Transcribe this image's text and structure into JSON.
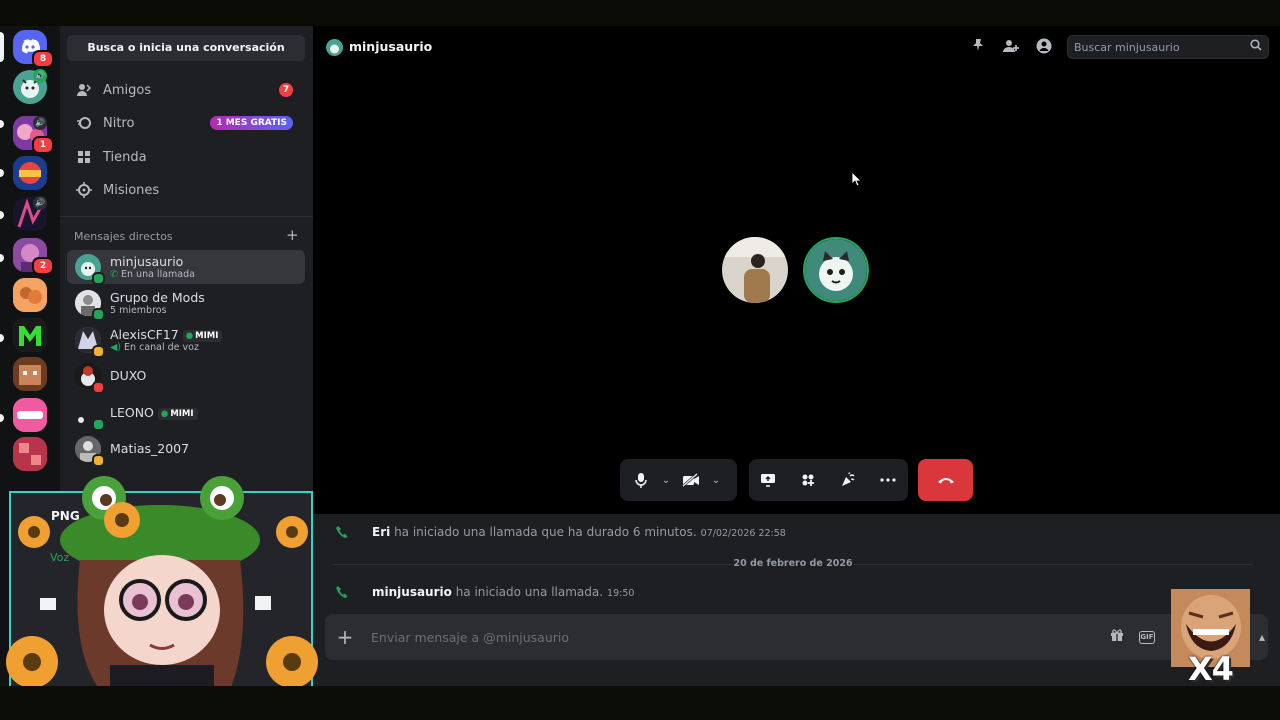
{
  "sidebar": {
    "search_label": "Busca o inicia una conversación",
    "nav": [
      {
        "label": "Amigos",
        "icon": "friends-icon",
        "badge": "7"
      },
      {
        "label": "Nitro",
        "icon": "nitro-icon",
        "promo": "1 MES GRATIS"
      },
      {
        "label": "Tienda",
        "icon": "shop-icon"
      },
      {
        "label": "Misiones",
        "icon": "quests-icon"
      }
    ],
    "dm_header": "Mensajes directos",
    "dms": [
      {
        "name": "minjusaurio",
        "sub": "En una llamada",
        "selected": true
      },
      {
        "name": "Grupo de Mods",
        "sub": "5 miembros"
      },
      {
        "name": "AlexisCF17",
        "tag": "MIMI",
        "sub": "En canal de voz"
      },
      {
        "name": "DUXO"
      },
      {
        "name": "LEONO",
        "tag": "MIMI"
      },
      {
        "name": "Matias_2007"
      }
    ],
    "partial_user": "PNG",
    "partial_voice": "Voz"
  },
  "rail": {
    "home_badge": "8",
    "server_badges": [
      "1",
      "2"
    ]
  },
  "header": {
    "channel_name": "minjusaurio",
    "search_placeholder": "Buscar minjusaurio"
  },
  "chat": {
    "messages": [
      {
        "author": "Eri",
        "text": "ha iniciado una llamada que ha durado 6 minutos.",
        "time": "07/02/2026 22:58"
      },
      {
        "author": "minjusaurio",
        "text": "ha iniciado una llamada.",
        "time": "19:50"
      }
    ],
    "date_separator": "20 de febrero de 2026",
    "composer_placeholder": "Enviar mensaje a @minjusaurio"
  },
  "overlay": {
    "multiplier": "X4"
  },
  "colors": {
    "accent": "#5865f2",
    "online": "#23a55a",
    "danger": "#da373c",
    "badge": "#f23f43"
  }
}
